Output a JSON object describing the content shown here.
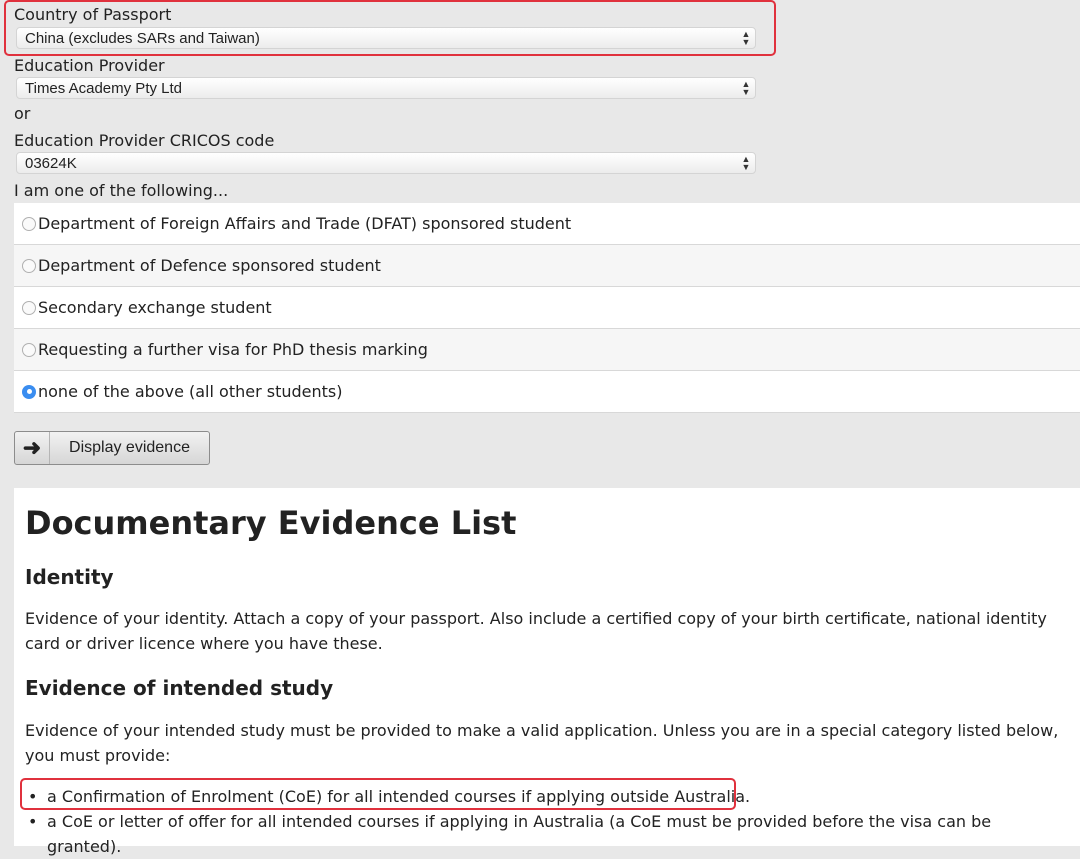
{
  "form": {
    "passport_label": "Country of Passport",
    "passport_value": "China (excludes SARs and Taiwan)",
    "provider_label": "Education Provider",
    "provider_value": "Times Academy Pty Ltd",
    "or_label": "or",
    "cricos_label": "Education Provider CRICOS code",
    "cricos_value": "03624K",
    "category_label": "I am one of the following...",
    "options": [
      {
        "label": "Department of Foreign Affairs and Trade (DFAT) sponsored student",
        "selected": false
      },
      {
        "label": "Department of Defence sponsored student",
        "selected": false
      },
      {
        "label": "Secondary exchange student",
        "selected": false
      },
      {
        "label": "Requesting a further visa for PhD thesis marking",
        "selected": false
      },
      {
        "label": "none of the above (all other students)",
        "selected": true
      }
    ],
    "display_button_label": "Display evidence"
  },
  "evidence": {
    "title": "Documentary Evidence List",
    "identity_heading": "Identity",
    "identity_text": "Evidence of your identity. Attach a copy of your passport. Also include a certified copy of your birth certificate, national identity card or driver licence where you have these.",
    "study_heading": "Evidence of intended study",
    "study_text": "Evidence of your intended study must be provided to make a valid application. Unless you are in a special category listed below, you must provide:",
    "items": [
      "a Confirmation of Enrolment (CoE) for all intended courses if applying outside Australia.",
      "a CoE or letter of offer for all intended courses if applying in Australia (a CoE must be provided before the visa can be granted)."
    ]
  },
  "colors": {
    "highlight": "#e0313d",
    "radio_selected": "#3a8df0",
    "form_background": "#e8e8e8"
  }
}
